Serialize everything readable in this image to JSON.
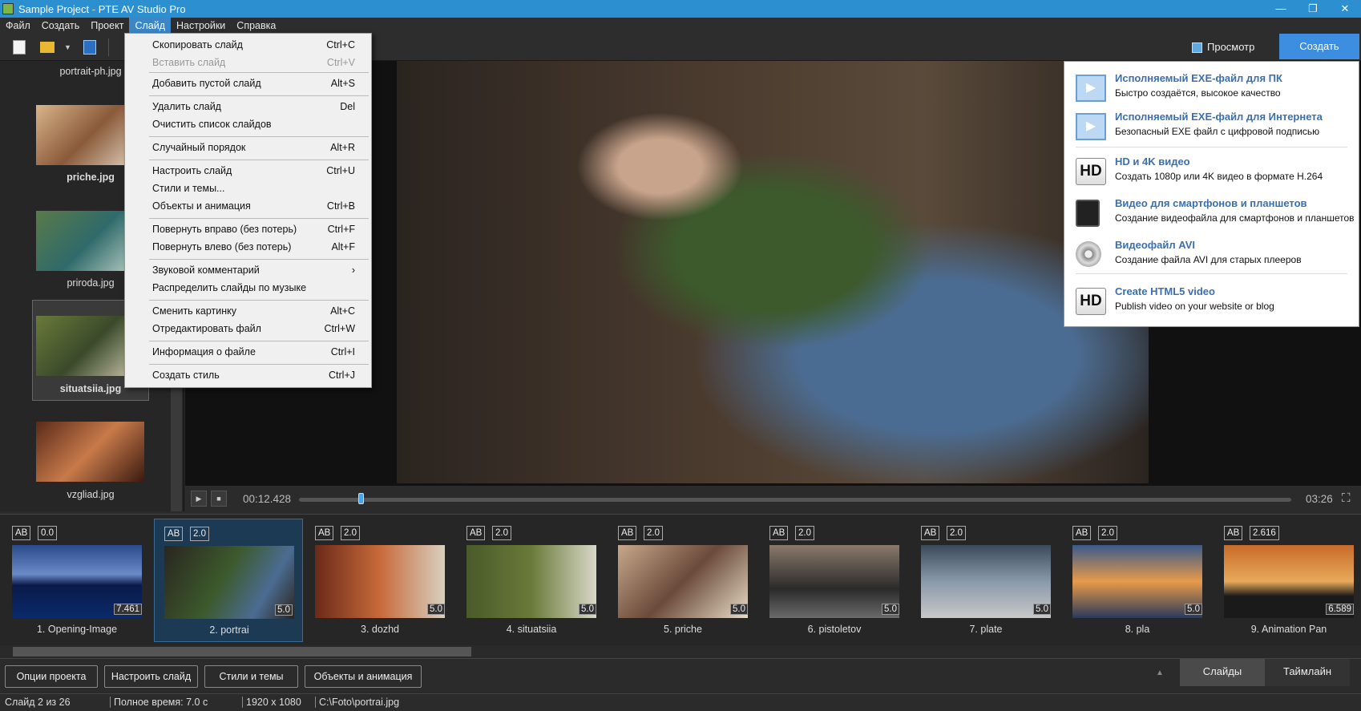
{
  "window": {
    "title": "Sample Project - PTE AV Studio Pro",
    "minimize": "—",
    "restore": "❐",
    "close": "✕"
  },
  "menubar": [
    "Файл",
    "Создать",
    "Проект",
    "Слайд",
    "Настройки",
    "Справка"
  ],
  "toolbar": {
    "view_label": "Просмотр",
    "create_label": "Создать"
  },
  "slide_menu": [
    {
      "label": "Скопировать слайд",
      "key": "Ctrl+C"
    },
    {
      "label": "Вставить слайд",
      "key": "Ctrl+V",
      "disabled": true
    },
    {
      "label": "Добавить пустой слайд",
      "key": "Alt+S"
    },
    {
      "label": "Удалить слайд",
      "key": "Del"
    },
    {
      "label": "Очистить список слайдов",
      "key": ""
    },
    {
      "label": "Случайный порядок",
      "key": "Alt+R"
    },
    {
      "label": "Настроить слайд",
      "key": "Ctrl+U"
    },
    {
      "label": "Стили и темы...",
      "key": ""
    },
    {
      "label": "Объекты и анимация",
      "key": "Ctrl+B"
    },
    {
      "label": "Повернуть вправо (без потерь)",
      "key": "Ctrl+F"
    },
    {
      "label": "Повернуть влево (без потерь)",
      "key": "Alt+F"
    },
    {
      "label": "Звуковой комментарий",
      "key": "›"
    },
    {
      "label": "Распределить слайды по музыке",
      "key": ""
    },
    {
      "label": "Сменить картинку",
      "key": "Alt+C"
    },
    {
      "label": "Отредактировать файл",
      "key": "Ctrl+W"
    },
    {
      "label": "Информация о файле",
      "key": "Ctrl+I"
    },
    {
      "label": "Создать стиль",
      "key": "Ctrl+J"
    }
  ],
  "create_menu": [
    {
      "title": "Исполняемый EXE-файл для ПК",
      "desc": "Быстро создаётся, высокое качество",
      "icon": "exe-play-icon"
    },
    {
      "title": "Исполняемый EXE-файл для Интернета",
      "desc": "Безопасный EXE файл с цифровой подписью",
      "icon": "exe-play-icon"
    },
    {
      "title": "HD и 4K видео",
      "desc": "Создать 1080p или 4K видео в формате H.264",
      "icon": "hd-icon",
      "icon_text": "HD"
    },
    {
      "title": "Видео для смартфонов и планшетов",
      "desc": "Создание видеофайла для смартфонов и планшетов",
      "icon": "tablet-phone-icon"
    },
    {
      "title": "Видеофайл AVI",
      "desc": "Создание файла AVI для старых плееров",
      "icon": "film-reel-icon"
    },
    {
      "title": "Create HTML5 video",
      "desc": "Publish video on your website or blog",
      "icon": "hd-icon",
      "icon_text": "HD"
    }
  ],
  "file_list": [
    "portrait-ph.jpg",
    "priche.jpg",
    "priroda.jpg",
    "situatsiia.jpg",
    "vzgliad.jpg"
  ],
  "playback": {
    "time": "00:12.428",
    "total": "03:26",
    "progress": 0.06
  },
  "slides": [
    {
      "name": "1. Opening-Image",
      "ab": "AB",
      "trans": "0.0",
      "dur": "7.461"
    },
    {
      "name": "2. portrai",
      "ab": "AB",
      "trans": "2.0",
      "dur": "5.0",
      "selected": true
    },
    {
      "name": "3. dozhd",
      "ab": "AB",
      "trans": "2.0",
      "dur": "5.0"
    },
    {
      "name": "4. situatsiia",
      "ab": "AB",
      "trans": "2.0",
      "dur": "5.0"
    },
    {
      "name": "5. priche",
      "ab": "AB",
      "trans": "2.0",
      "dur": "5.0"
    },
    {
      "name": "6. pistoletov",
      "ab": "AB",
      "trans": "2.0",
      "dur": "5.0"
    },
    {
      "name": "7. plate",
      "ab": "AB",
      "trans": "2.0",
      "dur": "5.0"
    },
    {
      "name": "8. pla",
      "ab": "AB",
      "trans": "2.0",
      "dur": "5.0"
    },
    {
      "name": "9. Animation Pan",
      "ab": "AB",
      "trans": "2.616",
      "dur": "6.589"
    }
  ],
  "buttons": [
    "Опции проекта",
    "Настроить слайд",
    "Стили и темы",
    "Объекты и анимация"
  ],
  "tabs": [
    "Слайды",
    "Таймлайн"
  ],
  "status": [
    "Слайд 2 из 26",
    "Полное время: 7.0 с",
    "1920 x 1080",
    "C:\\Foto\\portrai.jpg"
  ]
}
